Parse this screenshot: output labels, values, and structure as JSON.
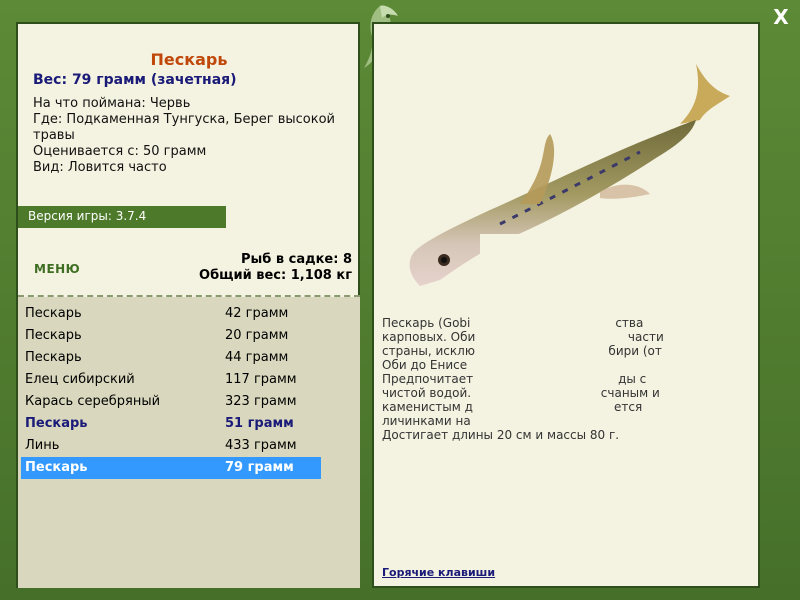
{
  "fish_card": {
    "title": "Пескарь",
    "weight_line": "Вес: 79 грамм (зачетная)",
    "info_lines": [
      "На что поймана: Червь",
      "Где: Подкаменная Тунгуска, Берег высокой травы",
      "Оценивается с: 50 грамм",
      "Вид: Ловится часто"
    ]
  },
  "version_label": "Версия игры: 3.7.4",
  "menu_label": "МЕНЮ",
  "cage": {
    "count_line": "Рыб в садке: 8",
    "total_weight_line": "Общий вес: 1,108 кг"
  },
  "catch_list": [
    {
      "name": "Пескарь",
      "weight": "42 грамм"
    },
    {
      "name": "Пескарь",
      "weight": "20 грамм"
    },
    {
      "name": "Пескарь",
      "weight": "44 грамм"
    },
    {
      "name": "Елец сибирский",
      "weight": "117 грамм"
    },
    {
      "name": "Карась серебряный",
      "weight": "323 грамм"
    },
    {
      "name": "Пескарь",
      "weight": "51 грамм",
      "record": true
    },
    {
      "name": "Линь",
      "weight": "433 грамм"
    },
    {
      "name": "Пескарь",
      "weight": "79 грамм",
      "selected": true
    }
  ],
  "description_lines": [
    "Пескарь (Gobi                                      ства",
    "карповых. Оби                                        части",
    "страны, исклю                                   бири (от",
    "Оби до Енисе",
    "Предпочитает                                      ды с",
    "чистой водой.                                  счаным и",
    "каменистым д                                     ется",
    "личинками на",
    "Достигает длины 20 см и массы 80 г."
  ],
  "hotkeys_label": "Горячие клавиши",
  "close_label": "X",
  "colors": {
    "frame": "#4e7a2c",
    "panel_bg": "#f4f2e0",
    "list_bg": "#d9d8be",
    "title_orange": "#c0480a",
    "navy": "#1a1a78",
    "selected_blue": "#3399ff"
  }
}
